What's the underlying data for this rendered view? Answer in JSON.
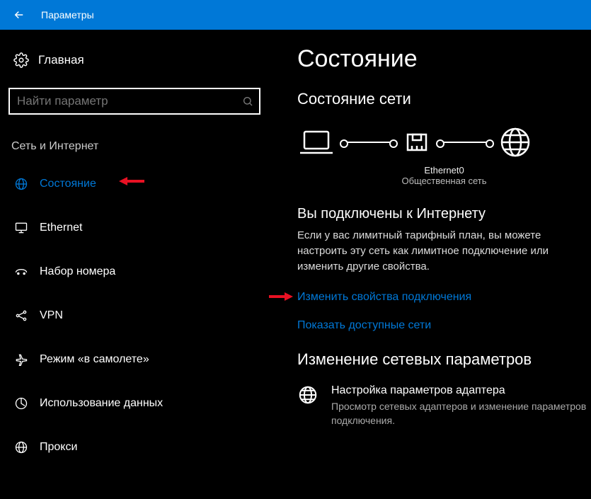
{
  "titlebar": {
    "title": "Параметры"
  },
  "sidebar": {
    "home": "Главная",
    "search_placeholder": "Найти параметр",
    "category": "Сеть и Интернет",
    "items": [
      {
        "label": "Состояние"
      },
      {
        "label": "Ethernet"
      },
      {
        "label": "Набор номера"
      },
      {
        "label": "VPN"
      },
      {
        "label": "Режим «в самолете»"
      },
      {
        "label": "Использование данных"
      },
      {
        "label": "Прокси"
      }
    ]
  },
  "content": {
    "page_title": "Состояние",
    "section_title": "Состояние сети",
    "net_name": "Ethernet0",
    "net_type": "Общественная сеть",
    "connected_title": "Вы подключены к Интернету",
    "connected_text": "Если у вас лимитный тарифный план, вы можете настроить эту сеть как лимитное подключение или изменить другие свойства.",
    "link1": "Изменить свойства подключения",
    "link2": "Показать доступные сети",
    "change_title": "Изменение сетевых параметров",
    "adapter_title": "Настройка параметров адаптера",
    "adapter_desc": "Просмотр сетевых адаптеров и изменение параметров подключения."
  }
}
